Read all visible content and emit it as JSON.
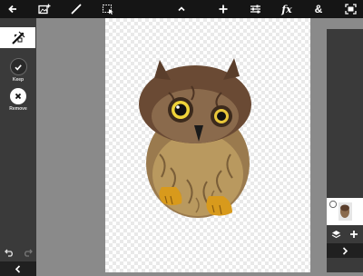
{
  "toolbar": {
    "icons": [
      "back-arrow-icon",
      "add-image-icon",
      "brush-icon",
      "selection-icon",
      "chevron-up-icon",
      "plus-icon",
      "adjustments-icon",
      "fx-icon",
      "ampersand-icon",
      "fit-screen-icon"
    ],
    "fx_label": "fx",
    "amp_label": "&"
  },
  "left_panel": {
    "keep_label": "Keep",
    "remove_label": "Remove"
  },
  "right_panel": {
    "icons": [
      "layers-icon",
      "add-layer-icon",
      "chevron-right-icon"
    ]
  },
  "colors": {
    "toolbar_bg": "#151515",
    "panel_bg": "#3a3a3a",
    "workspace_bg": "#8a8a8a"
  }
}
